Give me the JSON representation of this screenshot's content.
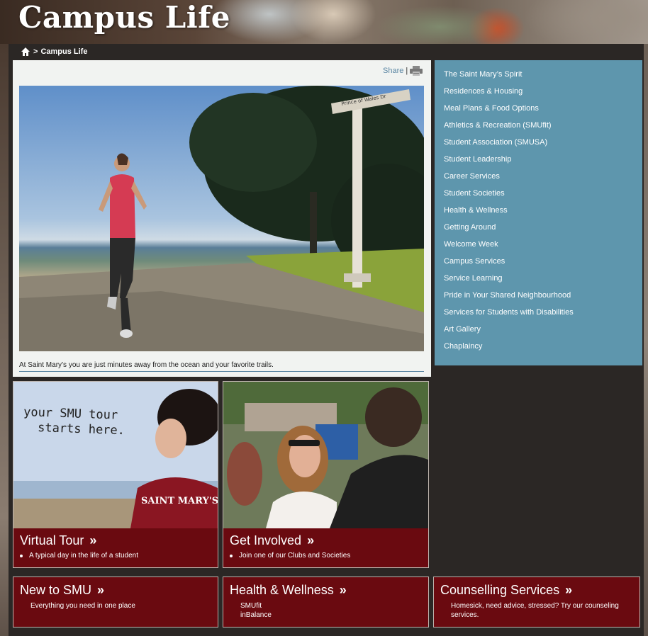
{
  "header": {
    "title": "Campus Life"
  },
  "breadcrumb": {
    "separator": ">",
    "current": "Campus Life"
  },
  "share": {
    "label": "Share",
    "separator": "|"
  },
  "feature": {
    "caption": "At Saint Mary’s you are just minutes away from the ocean and your favorite trails.",
    "sign_text": "Prince of Wales Dr"
  },
  "sidebar": {
    "items": [
      {
        "label": "The Saint Mary’s Spirit"
      },
      {
        "label": "Residences & Housing"
      },
      {
        "label": "Meal Plans & Food Options"
      },
      {
        "label": "Athletics & Recreation (SMUfit)"
      },
      {
        "label": "Student Association (SMUSA)"
      },
      {
        "label": "Student Leadership"
      },
      {
        "label": "Career Services"
      },
      {
        "label": "Student Societies"
      },
      {
        "label": "Health & Wellness"
      },
      {
        "label": "Getting Around"
      },
      {
        "label": "Welcome Week"
      },
      {
        "label": "Campus Services"
      },
      {
        "label": "Service Learning"
      },
      {
        "label": "Pride in Your Shared Neighbourhood"
      },
      {
        "label": "Services for Students with Disabilities"
      },
      {
        "label": "Art Gallery"
      },
      {
        "label": "Chaplaincy"
      }
    ]
  },
  "tiles": {
    "virtual_tour": {
      "title": "Virtual Tour",
      "arrow": "»",
      "bullet": "A typical day in the life of a student",
      "image_text_line1": "your SMU tour",
      "image_text_line2": "starts here.",
      "shirt_text": "SAINT MARY'S"
    },
    "get_involved": {
      "title": "Get Involved",
      "arrow": "»",
      "bullet": "Join one of our Clubs and Societies"
    },
    "new_to_smu": {
      "title": "New to SMU",
      "arrow": "»",
      "line1": "Everything you need in one place"
    },
    "health": {
      "title": "Health & Wellness",
      "arrow": "»",
      "line1": "SMUfit",
      "line2": "inBalance"
    },
    "counselling": {
      "title": "Counselling Services",
      "arrow": "»",
      "line1": "Homesick, need advice, stressed? Try our counseling",
      "line2": "services."
    }
  },
  "colors": {
    "maroon": "#6a0a10",
    "sidebar_blue": "#5e96ad",
    "link_blue": "#5a86a3"
  }
}
